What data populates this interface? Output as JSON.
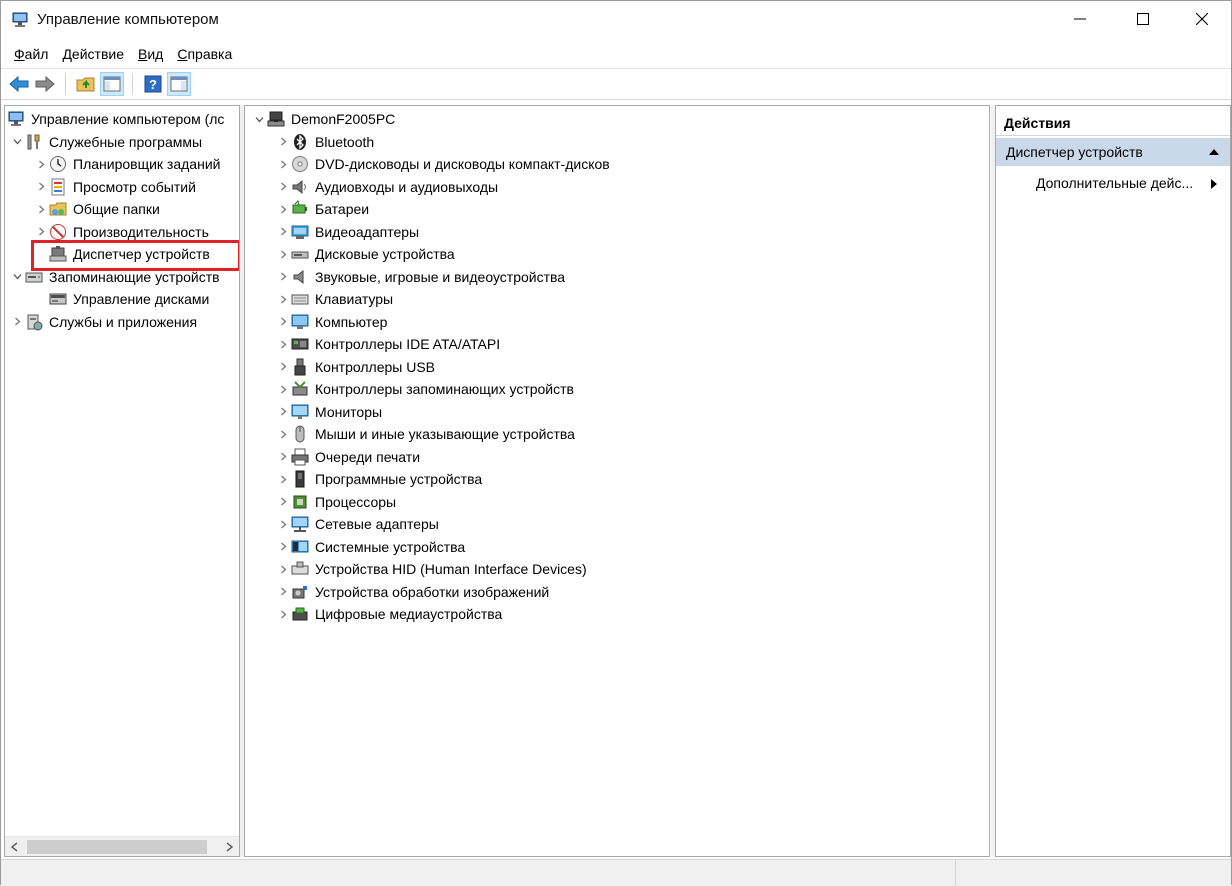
{
  "window": {
    "title": "Управление компьютером",
    "icon": "computer-management-icon"
  },
  "menu": [
    {
      "label": "Файл",
      "mnemonic_index": 0
    },
    {
      "label": "Действие",
      "mnemonic_index": 0
    },
    {
      "label": "Вид",
      "mnemonic_index": 0
    },
    {
      "label": "Справка",
      "mnemonic_index": 0
    }
  ],
  "toolbar": {
    "buttons": [
      "back-arrow-icon",
      "forward-arrow-icon",
      "up-folder-icon",
      "show-hide-console-tree-icon",
      "help-icon",
      "show-hide-action-pane-icon"
    ]
  },
  "left_tree": {
    "items": [
      {
        "label": "Управление компьютером (лс",
        "level": 0,
        "chevron": "none",
        "icon": "computer-management-icon"
      },
      {
        "label": "Служебные программы",
        "level": 1,
        "chevron": "down",
        "icon": "tools-icon"
      },
      {
        "label": "Планировщик заданий",
        "level": 2,
        "chevron": "right",
        "icon": "clock-icon"
      },
      {
        "label": "Просмотр событий",
        "level": 2,
        "chevron": "right",
        "icon": "event-viewer-icon"
      },
      {
        "label": "Общие папки",
        "level": 2,
        "chevron": "right",
        "icon": "shared-folders-icon"
      },
      {
        "label": "Производительность",
        "level": 2,
        "chevron": "right",
        "icon": "performance-icon"
      },
      {
        "label": "Диспетчер устройств",
        "level": 2,
        "chevron": "none",
        "icon": "device-manager-icon",
        "selected": true
      },
      {
        "label": "Запоминающие устройств",
        "level": 1,
        "chevron": "down",
        "icon": "storage-icon"
      },
      {
        "label": "Управление дисками",
        "level": 2,
        "chevron": "none",
        "icon": "disk-management-icon"
      },
      {
        "label": "Службы и приложения",
        "level": 1,
        "chevron": "right",
        "icon": "services-icon"
      }
    ]
  },
  "device_tree": {
    "root": {
      "label": "DemonF2005PC",
      "icon": "computer-root-icon"
    },
    "categories": [
      {
        "label": "Bluetooth",
        "icon": "bluetooth-icon"
      },
      {
        "label": "DVD-дисководы и дисководы компакт-дисков",
        "icon": "dvd-drive-icon"
      },
      {
        "label": "Аудиовходы и аудиовыходы",
        "icon": "audio-io-icon"
      },
      {
        "label": "Батареи",
        "icon": "battery-icon"
      },
      {
        "label": "Видеоадаптеры",
        "icon": "display-adapter-icon"
      },
      {
        "label": "Дисковые устройства",
        "icon": "disk-drive-icon"
      },
      {
        "label": "Звуковые, игровые и видеоустройства",
        "icon": "sound-icon"
      },
      {
        "label": "Клавиатуры",
        "icon": "keyboard-icon"
      },
      {
        "label": "Компьютер",
        "icon": "computer-icon"
      },
      {
        "label": "Контроллеры IDE ATA/ATAPI",
        "icon": "ide-controller-icon"
      },
      {
        "label": "Контроллеры USB",
        "icon": "usb-icon"
      },
      {
        "label": "Контроллеры запоминающих устройств",
        "icon": "storage-controller-icon"
      },
      {
        "label": "Мониторы",
        "icon": "monitor-icon"
      },
      {
        "label": "Мыши и иные указывающие устройства",
        "icon": "mouse-icon"
      },
      {
        "label": "Очереди печати",
        "icon": "printer-icon"
      },
      {
        "label": "Программные устройства",
        "icon": "software-device-icon"
      },
      {
        "label": "Процессоры",
        "icon": "processor-icon"
      },
      {
        "label": "Сетевые адаптеры",
        "icon": "network-adapter-icon"
      },
      {
        "label": "Системные устройства",
        "icon": "system-device-icon"
      },
      {
        "label": "Устройства HID (Human Interface Devices)",
        "icon": "hid-icon"
      },
      {
        "label": "Устройства обработки изображений",
        "icon": "imaging-device-icon"
      },
      {
        "label": "Цифровые медиаустройства",
        "icon": "digital-media-icon"
      }
    ]
  },
  "actions": {
    "header": "Действия",
    "section": "Диспетчер устройств",
    "item": "Дополнительные дейс..."
  },
  "colors": {
    "highlight_box": "#e0212b",
    "actions_section_bg": "#c9d9ea"
  }
}
